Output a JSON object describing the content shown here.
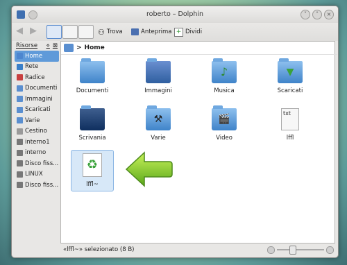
{
  "window": {
    "title": "roberto – Dolphin"
  },
  "toolbar": {
    "find_label": "Trova",
    "preview_label": "Anteprima",
    "split_label": "Dividi"
  },
  "sidebar": {
    "title": "Risorse",
    "items": [
      {
        "label": "Home",
        "icon": "home-icon",
        "color": "#4d86cf",
        "selected": true
      },
      {
        "label": "Rete",
        "icon": "network-icon",
        "color": "#3a7fc8"
      },
      {
        "label": "Radice",
        "icon": "root-folder-icon",
        "color": "#c84040"
      },
      {
        "label": "Documenti",
        "icon": "documents-folder-icon",
        "color": "#5a8fd0"
      },
      {
        "label": "Immagini",
        "icon": "pictures-folder-icon",
        "color": "#5a8fd0"
      },
      {
        "label": "Scaricati",
        "icon": "downloads-folder-icon",
        "color": "#5a8fd0"
      },
      {
        "label": "Varie",
        "icon": "misc-folder-icon",
        "color": "#5a8fd0"
      },
      {
        "label": "Cestino",
        "icon": "trash-icon",
        "color": "#9a9a9a"
      },
      {
        "label": "interno1",
        "icon": "drive-icon",
        "color": "#777777"
      },
      {
        "label": "interno",
        "icon": "drive-icon",
        "color": "#777777"
      },
      {
        "label": "Disco fiss...",
        "icon": "drive-icon",
        "color": "#777777"
      },
      {
        "label": "LINUX",
        "icon": "drive-icon",
        "color": "#777777"
      },
      {
        "label": "Disco fiss...",
        "icon": "drive-icon",
        "color": "#777777"
      }
    ]
  },
  "breadcrumb": {
    "label": "Home"
  },
  "files": [
    {
      "name": "Documenti",
      "icon": "documents-folder-icon"
    },
    {
      "name": "Immagini",
      "icon": "pictures-folder-icon"
    },
    {
      "name": "Musica",
      "icon": "music-folder-icon"
    },
    {
      "name": "Scaricati",
      "icon": "downloads-folder-icon"
    },
    {
      "name": "Scrivania",
      "icon": "desktop-folder-icon"
    },
    {
      "name": "Varie",
      "icon": "tools-folder-icon"
    },
    {
      "name": "Video",
      "icon": "video-folder-icon"
    },
    {
      "name": "lffl",
      "icon": "text-file-icon",
      "badge": "txt"
    },
    {
      "name": "lffl~",
      "icon": "recycle-file-icon",
      "selected": true
    }
  ],
  "status": {
    "text": "«lffl~» selezionato (8 B)"
  },
  "zoom": {
    "level": 0.3
  }
}
